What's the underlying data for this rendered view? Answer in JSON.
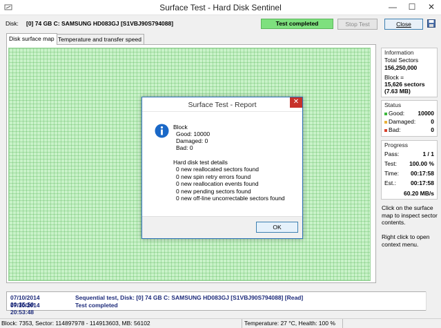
{
  "window": {
    "title": "Surface Test - Hard Disk Sentinel",
    "minimize": "—",
    "maximize": "☐",
    "close": "✕"
  },
  "diskbar": {
    "label": "Disk:",
    "disk_name": "[0] 74 GB C: SAMSUNG HD083GJ [S1VBJ90S794088]",
    "status": "Test completed",
    "stop_button": "Stop Test",
    "close_button": "Close"
  },
  "tabs": [
    {
      "label": "Disk surface map"
    },
    {
      "label": "Temperature and transfer speed"
    }
  ],
  "information": {
    "title": "Information",
    "total_sectors_label": "Total Sectors",
    "total_sectors": "156,250,000",
    "block_label": "Block =",
    "block_sectors": "15,626 sectors",
    "block_size": "(7.63 MB)"
  },
  "status_panel": {
    "title": "Status",
    "good_label": "Good:",
    "good": "10000",
    "damaged_label": "Damaged:",
    "damaged": "0",
    "bad_label": "Bad:",
    "bad": "0",
    "colors": {
      "good": "#3cb83c",
      "damaged": "#e8b23a",
      "bad": "#d9402b"
    }
  },
  "progress": {
    "title": "Progress",
    "pass_label": "Pass:",
    "pass": "1 / 1",
    "test_label": "Test:",
    "test": "100.00 %",
    "time_label": "Time:",
    "time": "00:17:58",
    "est_label": "Est.:",
    "est": "00:17:58",
    "speed": "60.20 MB/s"
  },
  "hints": {
    "click": "Click on the surface map to inspect sector contents.",
    "right_click": "Right click to open context menu."
  },
  "log": [
    {
      "time": "07/10/2014  20:35:50",
      "message": "Sequential test, Disk: [0] 74 GB C: SAMSUNG HD083GJ [S1VBJ90S794088] [Read]"
    },
    {
      "time": "07/10/2014  20:53:48",
      "message": "Test completed"
    }
  ],
  "statusbar": {
    "left": "Block: 7353, Sector: 114897978 - 114913603, MB: 56102",
    "right": "Temperature: 27 °C,  Health: 100 %"
  },
  "dialog": {
    "title": "Surface Test - Report",
    "close": "✕",
    "lines": [
      "Block",
      "  Good: 10000",
      "  Damaged: 0",
      "  Bad: 0",
      "",
      "Hard disk test details",
      "  0 new reallocated sectors found",
      "  0 new spin retry errors found",
      "  0 new reallocation events found",
      "  0 new pending sectors found",
      "  0 new off-line uncorrectable sectors found"
    ],
    "ok_button": "OK"
  }
}
